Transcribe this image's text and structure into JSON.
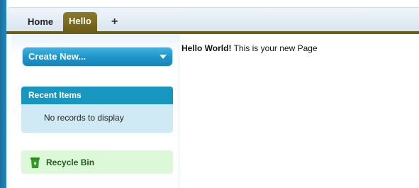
{
  "tabs": {
    "home_label": "Home",
    "hello_label": "Hello",
    "add_label": "+"
  },
  "sidebar": {
    "create_new_label": "Create New...",
    "recent_items": {
      "title": "Recent Items",
      "empty_text": "No records to display"
    },
    "recycle_bin": {
      "label": "Recycle Bin",
      "icon": "recycle-bin-icon"
    }
  },
  "main": {
    "message_bold": "Hello World!",
    "message_rest": " This is your new Page"
  },
  "colors": {
    "active_tab": "#6b5e16",
    "create_button": "#1f93c8",
    "recent_header": "#1797c0",
    "recent_body": "#cfeaf5",
    "recycle_bg": "#ddf7d9",
    "recycle_text": "#1f5d1a"
  }
}
